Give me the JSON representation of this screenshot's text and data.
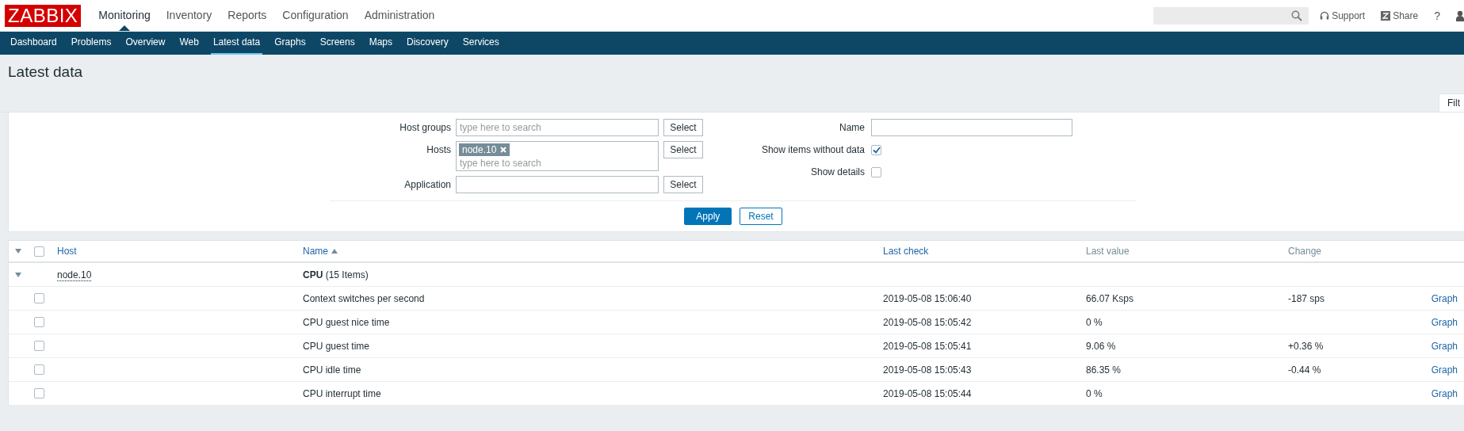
{
  "header": {
    "logo": "ZABBIX",
    "menu": [
      {
        "label": "Monitoring",
        "selected": true
      },
      {
        "label": "Inventory",
        "selected": false
      },
      {
        "label": "Reports",
        "selected": false
      },
      {
        "label": "Configuration",
        "selected": false
      },
      {
        "label": "Administration",
        "selected": false
      }
    ],
    "support": "Support",
    "share": "Share",
    "help": "?"
  },
  "submenu": [
    {
      "label": "Dashboard",
      "selected": false
    },
    {
      "label": "Problems",
      "selected": false
    },
    {
      "label": "Overview",
      "selected": false
    },
    {
      "label": "Web",
      "selected": false
    },
    {
      "label": "Latest data",
      "selected": true
    },
    {
      "label": "Graphs",
      "selected": false
    },
    {
      "label": "Screens",
      "selected": false
    },
    {
      "label": "Maps",
      "selected": false
    },
    {
      "label": "Discovery",
      "selected": false
    },
    {
      "label": "Services",
      "selected": false
    }
  ],
  "page_title": "Latest data",
  "filter_tab": "Filt",
  "filter": {
    "host_groups": {
      "label": "Host groups",
      "placeholder": "type here to search",
      "button": "Select"
    },
    "hosts": {
      "label": "Hosts",
      "tags": [
        "node.10"
      ],
      "placeholder": "type here to search",
      "button": "Select"
    },
    "application": {
      "label": "Application",
      "button": "Select"
    },
    "name": {
      "label": "Name"
    },
    "show_items_without_data": {
      "label": "Show items without data",
      "checked": true
    },
    "show_details": {
      "label": "Show details",
      "checked": false
    },
    "apply": "Apply",
    "reset": "Reset"
  },
  "table": {
    "select_all_checked": false,
    "columns": [
      {
        "label": "Host",
        "sortable": true,
        "sorted": false
      },
      {
        "label": "Name",
        "sortable": true,
        "sorted": true
      },
      {
        "label": "Last check",
        "sortable": true,
        "sorted": false
      },
      {
        "label": "Last value",
        "sortable": false,
        "sorted": false
      },
      {
        "label": "Change",
        "sortable": false,
        "sorted": false
      }
    ],
    "group": {
      "host": "node.10",
      "expanded": true,
      "application": "**CPU** (15 Items)"
    },
    "rows": [
      {
        "checked": false,
        "name": "Context switches per second",
        "last_check": "2019-05-08 15:06:40",
        "last_value": "66.07 Ksps",
        "change": "-187 sps",
        "link": "Graph"
      },
      {
        "checked": false,
        "name": "CPU guest nice time",
        "last_check": "2019-05-08 15:05:42",
        "last_value": "0 %",
        "link": "Graph"
      },
      {
        "checked": false,
        "name": "CPU guest time",
        "last_check": "2019-05-08 15:05:41",
        "last_value": "9.06 %",
        "change": "+0.36 %",
        "link": "Graph"
      },
      {
        "checked": false,
        "name": "CPU idle time",
        "last_check": "2019-05-08 15:05:43",
        "last_value": "86.35 %",
        "change": "-0.44 %",
        "link": "Graph"
      },
      {
        "checked": false,
        "name": "CPU interrupt time",
        "last_check": "2019-05-08 15:05:44",
        "last_value": "0 %",
        "link": "Graph"
      }
    ]
  }
}
